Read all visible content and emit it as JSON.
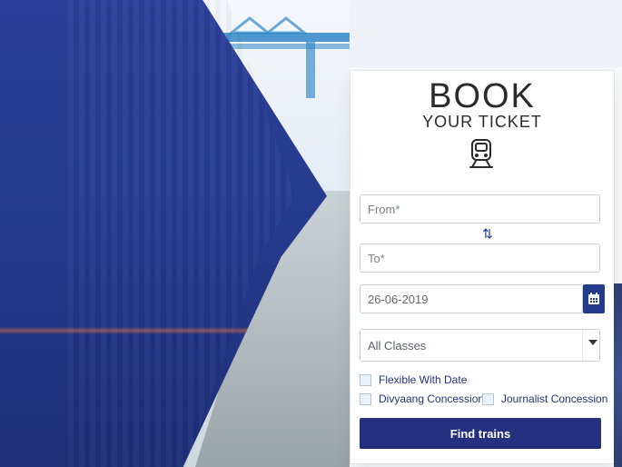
{
  "booking": {
    "title_big": "BOOK",
    "title_small": "YOUR TICKET",
    "from_placeholder": "From*",
    "to_placeholder": "To*",
    "date_value": "26-06-2019",
    "class_value": "All Classes",
    "checkbox_flexible": "Flexible With Date",
    "checkbox_divyaang": "Divyaang Concession",
    "checkbox_journalist": "Journalist Concession",
    "find_button": "Find trains"
  },
  "colors": {
    "primary": "#25317f",
    "border": "#c9d0d7"
  },
  "icons": {
    "train": "train-icon",
    "swap": "swap-icon",
    "calendar": "calendar-icon",
    "dropdown": "chevron-down-icon"
  }
}
